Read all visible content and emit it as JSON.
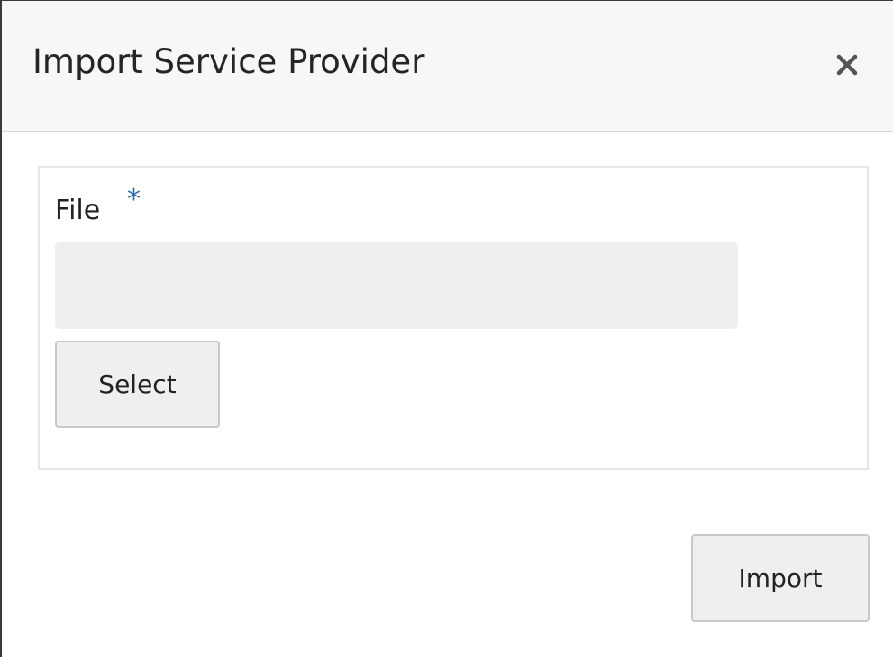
{
  "dialog": {
    "title": "Import Service Provider",
    "close_icon": "close-x-icon"
  },
  "form": {
    "file_label": "File",
    "required_mark": "*",
    "file_value": "",
    "select_label": "Select"
  },
  "footer": {
    "import_label": "Import"
  },
  "colors": {
    "header_background": "#f7f7f7",
    "button_background": "#efefef",
    "required_mark": "#2f6fa3"
  }
}
